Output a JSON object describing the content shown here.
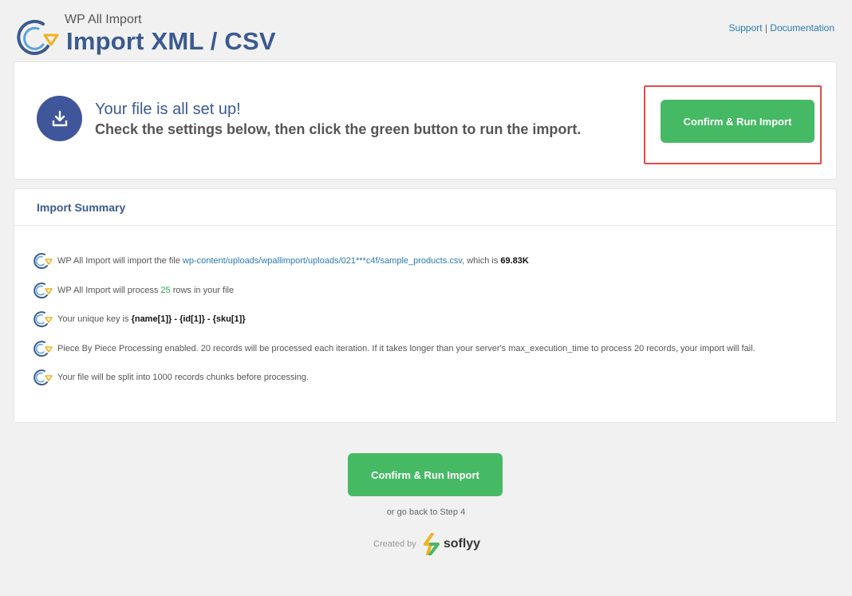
{
  "header": {
    "app_name": "WP All Import",
    "title": "Import XML / CSV",
    "support_link": "Support",
    "separator": "|",
    "documentation_link": "Documentation"
  },
  "setup": {
    "title": "Your file is all set up!",
    "subtitle": "Check the settings below, then click the green button to run the import.",
    "button": "Confirm & Run Import"
  },
  "summary": {
    "title": "Import Summary",
    "file_line": {
      "prefix": "WP All Import will import the file",
      "file_path": "wp-content/uploads/wpallimport/uploads/021***c4f/sample_products.csv",
      "mid": ", which is",
      "size": "69.83K"
    },
    "rows_line": {
      "prefix": "WP All Import will process",
      "count": "25",
      "suffix": "rows in your file"
    },
    "key_line": {
      "prefix": "Your unique key is",
      "key": "{name[1]} - {id[1]} - {sku[1]}"
    },
    "piece_line": "Piece By Piece Processing enabled. 20 records will be processed each iteration. If it takes longer than your server's max_execution_time to process 20 records, your import will fail.",
    "split_line": "Your file will be split into 1000 records chunks before processing."
  },
  "footer": {
    "button": "Confirm & Run Import",
    "back_link": "or go back to Step 4",
    "created_by": "Created by",
    "brand": "soflyy"
  },
  "colors": {
    "accent_blue": "#3b5a8f",
    "button_green": "#46b964",
    "highlight_red": "#e04b4b"
  },
  "icons": [
    "wpai-logo-icon",
    "download-icon",
    "refresh-arrow-icon",
    "soflyy-logo-icon"
  ]
}
